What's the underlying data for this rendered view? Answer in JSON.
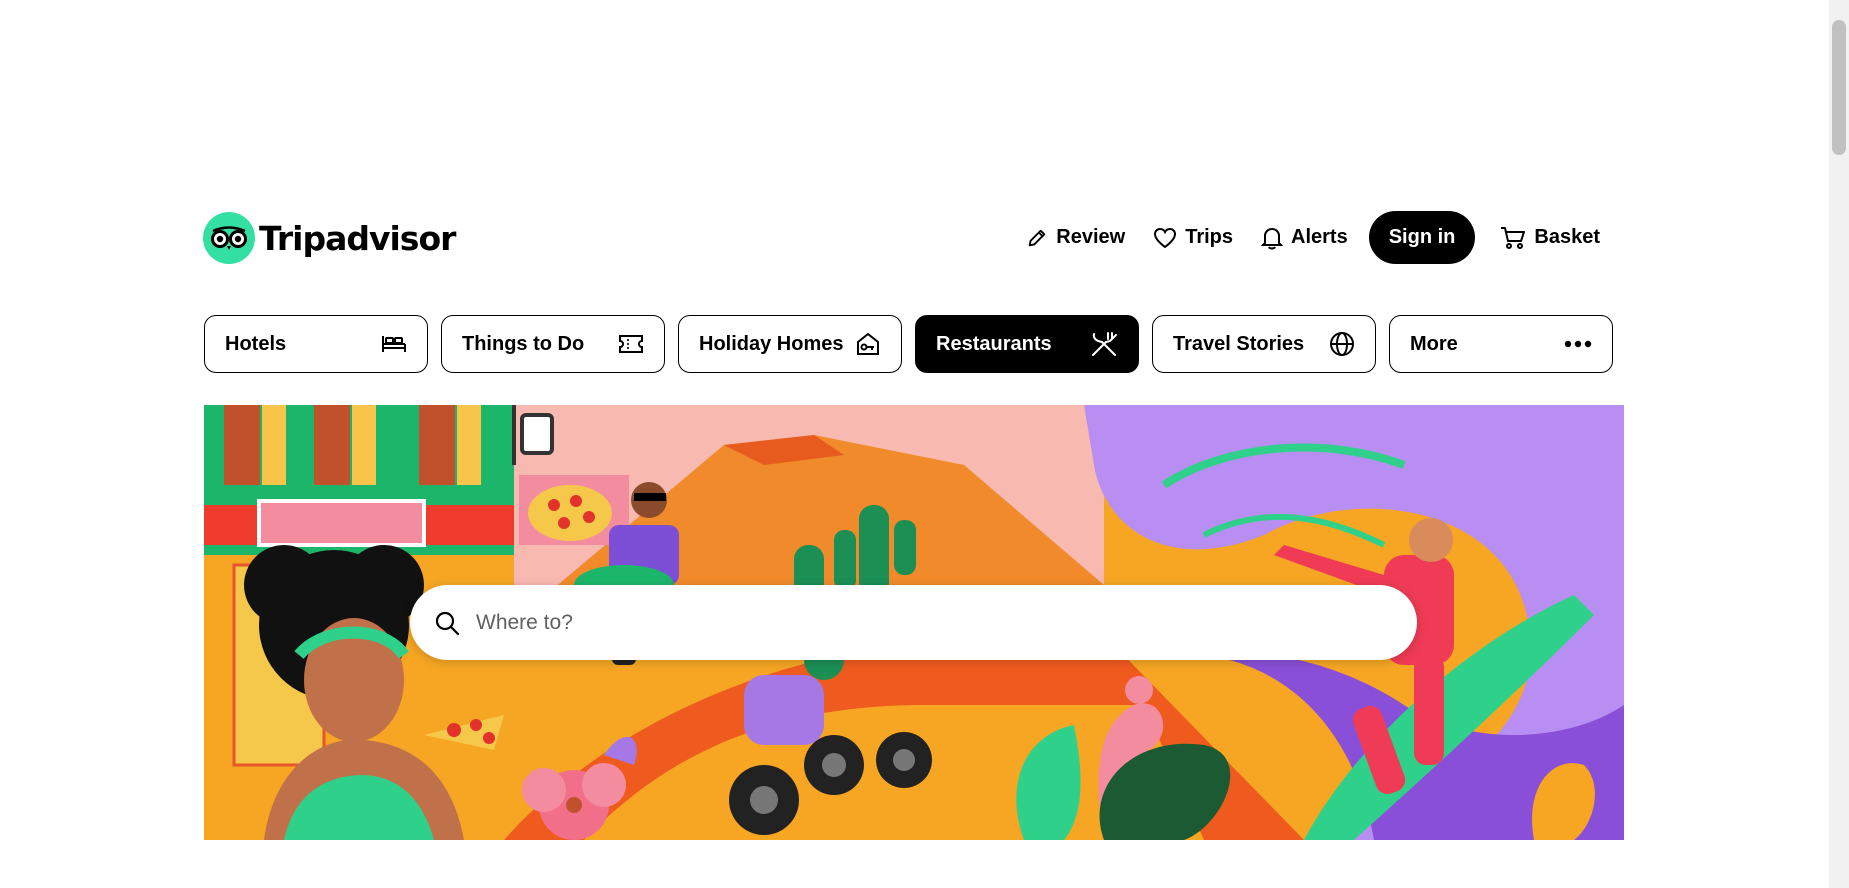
{
  "brand": {
    "name": "Tripadvisor",
    "accent": "#34e0a1"
  },
  "header": {
    "review_label": "Review",
    "trips_label": "Trips",
    "alerts_label": "Alerts",
    "signin_label": "Sign in",
    "basket_label": "Basket"
  },
  "tabs": [
    {
      "label": "Hotels",
      "icon": "bed-icon",
      "active": false
    },
    {
      "label": "Things to Do",
      "icon": "ticket-icon",
      "active": false
    },
    {
      "label": "Holiday Homes",
      "icon": "house-key-icon",
      "active": false
    },
    {
      "label": "Restaurants",
      "icon": "cutlery-icon",
      "active": true
    },
    {
      "label": "Travel Stories",
      "icon": "globe-icon",
      "active": false
    },
    {
      "label": "More",
      "icon": "more-dots-icon",
      "active": false
    }
  ],
  "search": {
    "placeholder": "Where to?",
    "value": ""
  }
}
